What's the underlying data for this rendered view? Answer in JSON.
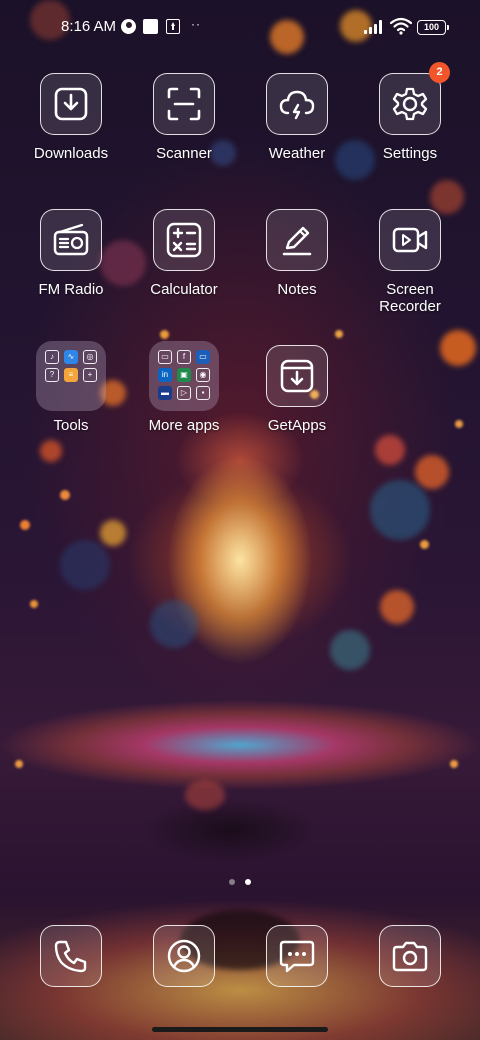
{
  "status_bar": {
    "time": "8:16 AM",
    "battery": "100",
    "more_indicator": "··"
  },
  "apps": [
    {
      "label": "Downloads",
      "icon": "download-icon"
    },
    {
      "label": "Scanner",
      "icon": "scan-icon"
    },
    {
      "label": "Weather",
      "icon": "weather-cloud-icon"
    },
    {
      "label": "Settings",
      "icon": "gear-icon",
      "badge": "2"
    },
    {
      "label": "FM Radio",
      "icon": "radio-icon"
    },
    {
      "label": "Calculator",
      "icon": "calculator-icon"
    },
    {
      "label": "Notes",
      "icon": "pencil-icon"
    },
    {
      "label_line1": "Screen",
      "label_line2": "Recorder",
      "icon": "video-camera-icon"
    },
    {
      "label": "Tools",
      "icon": "folder-icon"
    },
    {
      "label": "More apps",
      "icon": "folder-icon"
    },
    {
      "label": "GetApps",
      "icon": "box-download-icon"
    }
  ],
  "dock": [
    {
      "name": "phone",
      "icon": "phone-icon"
    },
    {
      "name": "contacts",
      "icon": "contact-person-icon"
    },
    {
      "name": "messages",
      "icon": "message-bubble-icon"
    },
    {
      "name": "camera",
      "icon": "camera-icon"
    }
  ],
  "pager": {
    "pages": 2,
    "active": 2
  }
}
